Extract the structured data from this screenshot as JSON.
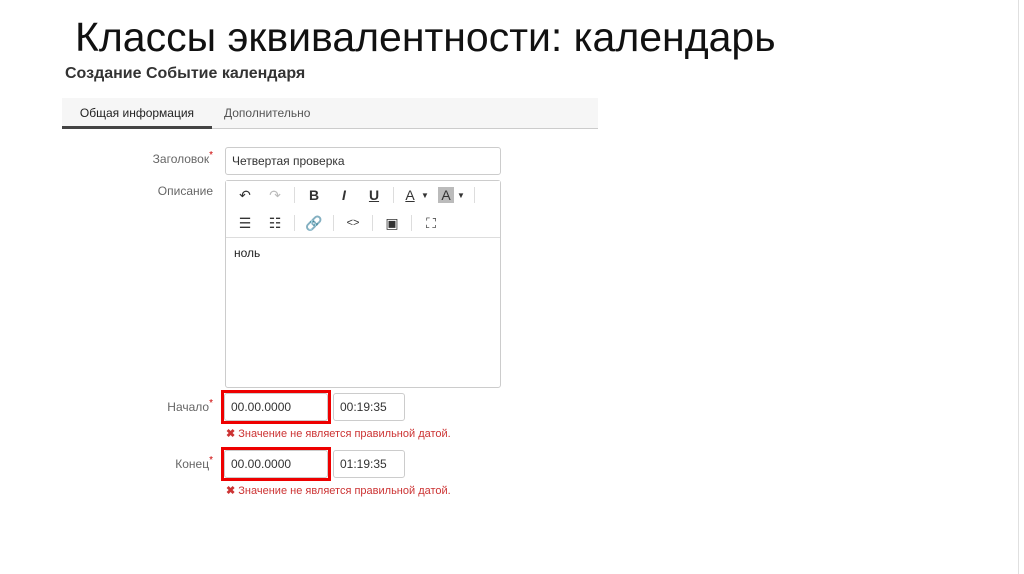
{
  "slide_title": "Классы эквивалентности: календарь",
  "form_title": "Создание Событие календаря",
  "tabs": [
    {
      "label": "Общая информация",
      "active": true
    },
    {
      "label": "Дополнительно",
      "active": false
    }
  ],
  "fields": {
    "title": {
      "label": "Заголовок",
      "required": "*",
      "value": "Четвертая проверка"
    },
    "description": {
      "label": "Описание",
      "value": "ноль"
    },
    "start": {
      "label": "Начало",
      "required": "*",
      "date": "00.00.0000",
      "time": "00:19:35",
      "error": "Значение не является правильной датой.",
      "error_icon": "✖"
    },
    "end": {
      "label": "Конец",
      "required": "*",
      "date": "00.00.0000",
      "time": "01:19:35",
      "error": "Значение не является правильной датой.",
      "error_icon": "✖"
    }
  },
  "toolbar": {
    "bold": "B",
    "italic": "I",
    "underline": "U",
    "font_color": "A",
    "bg_color": "A",
    "code": "<>"
  },
  "colors": {
    "error": "#e00000",
    "error_text": "#cc3333"
  }
}
